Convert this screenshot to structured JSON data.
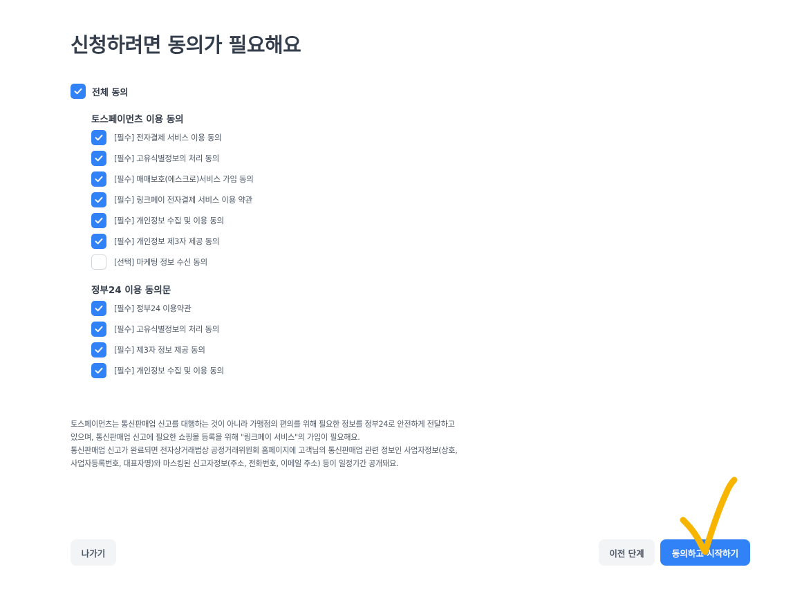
{
  "title": "신청하려면 동의가 필요해요",
  "all_agree": {
    "label": "전체 동의",
    "checked": true
  },
  "sections": [
    {
      "title": "토스페이먼츠 이용 동의",
      "items": [
        {
          "label": "[필수] 전자결제 서비스 이용 동의",
          "checked": true
        },
        {
          "label": "[필수] 고유식별정보의 처리 동의",
          "checked": true
        },
        {
          "label": "[필수] 매매보호(에스크로)서비스 가입 동의",
          "checked": true
        },
        {
          "label": "[필수] 링크페이 전자결제 서비스 이용 약관",
          "checked": true
        },
        {
          "label": "[필수] 개인정보 수집 및 이용 동의",
          "checked": true
        },
        {
          "label": "[필수] 개인정보 제3자 제공 동의",
          "checked": true
        },
        {
          "label": "[선택] 마케팅 정보 수신 동의",
          "checked": false
        }
      ]
    },
    {
      "title": "정부24 이용 동의문",
      "items": [
        {
          "label": "[필수] 정부24 이용약관",
          "checked": true
        },
        {
          "label": "[필수] 고유식별정보의 처리 동의",
          "checked": true
        },
        {
          "label": "[필수] 제3자 정보 제공 동의",
          "checked": true
        },
        {
          "label": "[필수] 개인정보 수집 및 이용 동의",
          "checked": true
        }
      ]
    }
  ],
  "notice": [
    "토스페이먼츠는 통신판매업 신고를 대행하는 것이 아니라 가맹점의 편의를 위해 필요한 정보를 정부24로 안전하게 전달하고",
    "있으며, 통신판매업 신고에 필요한 쇼핑몰 등록을 위해 \"링크페이 서비스\"의 가입이 필요해요.",
    "통신판매업 신고가 완료되면 전자상거래법상 공정거래위원회 홈페이지에 고객님의 통신판매업 관련 정보인 사업자정보(상호,",
    "사업자등록번호, 대표자명)와 마스킹된 신고자정보(주소, 전화번호, 이메일 주소) 등이 일정기간 공개돼요."
  ],
  "buttons": {
    "exit": "나가기",
    "prev": "이전 단계",
    "agree": "동의하고 시작하기"
  },
  "colors": {
    "accent": "#3182f6",
    "annotation": "#f7b500"
  },
  "icons": {
    "check": "check-icon"
  }
}
